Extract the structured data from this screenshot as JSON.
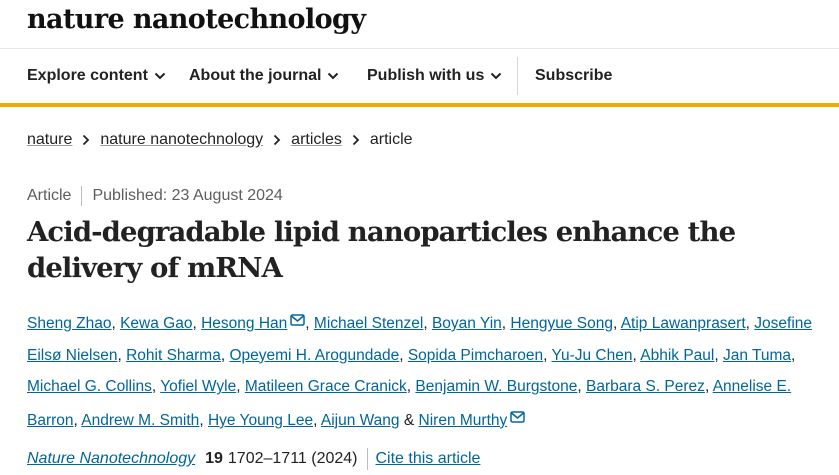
{
  "site": {
    "logo": "nature nanotechnology"
  },
  "nav": {
    "explore": "Explore content",
    "about": "About the journal",
    "publish": "Publish with us",
    "subscribe": "Subscribe"
  },
  "breadcrumb": [
    "nature",
    "nature nanotechnology",
    "articles",
    "article"
  ],
  "article": {
    "type": "Article",
    "published": "Published: 23 August 2024",
    "title": "Acid-degradable lipid nanoparticles enhance the delivery of mRNA",
    "authors": [
      "Sheng Zhao",
      "Kewa Gao",
      "Hesong Han",
      "Michael Stenzel",
      "Boyan Yin",
      "Hengyue Song",
      "Atip Lawanprasert",
      "Josefine Eilsø Nielsen",
      "Rohit Sharma",
      "Opeyemi H. Arogundade",
      "Sopida Pimcharoen",
      "Yu-Ju Chen",
      "Abhik Paul",
      "Jan Tuma",
      "Michael G. Collins",
      "Yofiel Wyle",
      "Matileen Grace Cranick",
      "Benjamin W. Burgstone",
      "Barbara S. Perez",
      "Annelise E. Barron",
      "Andrew M. Smith",
      "Hye Young Lee",
      "Aijun Wang",
      "Niren Murthy"
    ],
    "and": "&",
    "citation": {
      "journal": "Nature Nanotechnology",
      "volume": "19",
      "pages": "1702–1711 (2024)",
      "cite_link": "Cite this article"
    }
  },
  "colors": {
    "accent": "#f2a900",
    "link": "#006699",
    "text": "#222222",
    "muted": "#5d5d5d"
  },
  "icons": {
    "nav_dropdown": "chevron-down-icon",
    "breadcrumb_separator": "chevron-right-icon",
    "corresponding_author": "envelope-icon"
  }
}
